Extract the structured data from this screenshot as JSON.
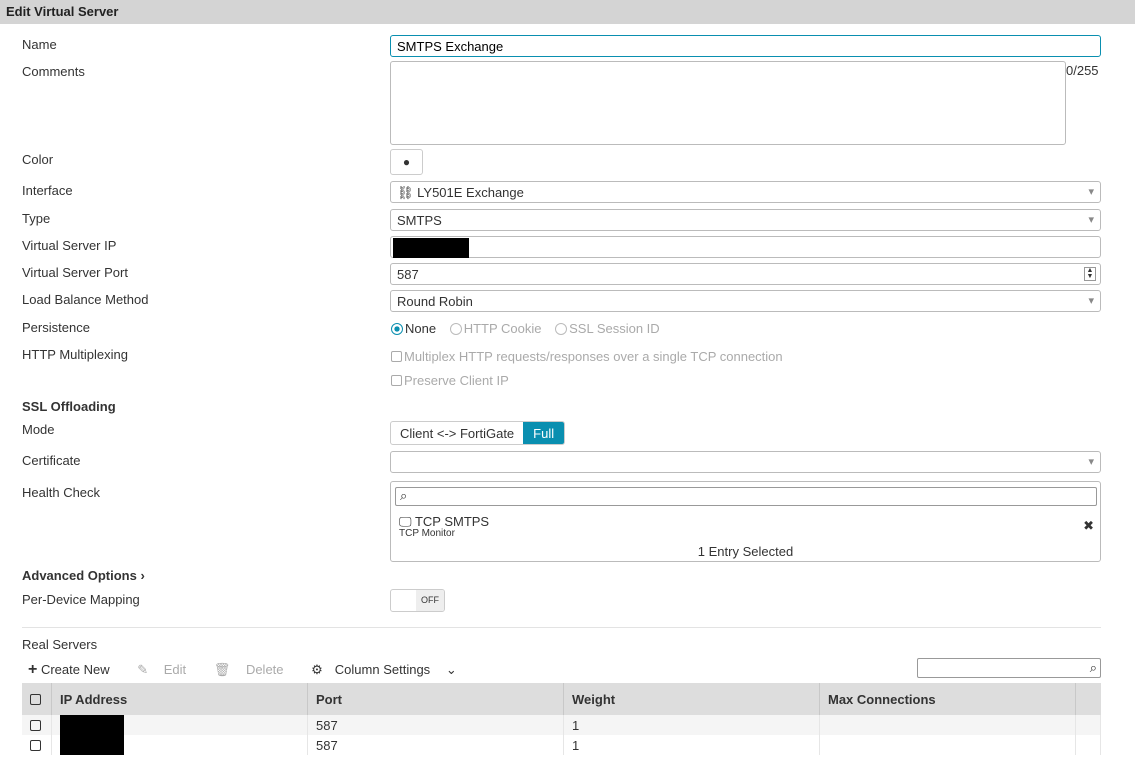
{
  "title": "Edit Virtual Server",
  "labels": {
    "name": "Name",
    "comments": "Comments",
    "color": "Color",
    "interface": "Interface",
    "type": "Type",
    "vip": "Virtual Server IP",
    "vport": "Virtual Server Port",
    "lbm": "Load Balance Method",
    "persistence": "Persistence",
    "http_mux": "HTTP Multiplexing",
    "ssl": "SSL Offloading",
    "mode": "Mode",
    "cert": "Certificate",
    "health": "Health Check",
    "advanced": "Advanced Options",
    "pdm": "Per-Device Mapping",
    "real_servers": "Real Servers"
  },
  "fields": {
    "name": "SMTPS Exchange",
    "comments_count": "0/255",
    "interface": "LY501E Exchange",
    "type": "SMTPS",
    "vport": "587",
    "lbm": "Round Robin",
    "certificate": ""
  },
  "persistence": {
    "options": [
      "None",
      "HTTP Cookie",
      "SSL Session ID"
    ],
    "selected": "None"
  },
  "http": {
    "multiplex": "Multiplex HTTP requests/responses over a single TCP connection",
    "preserve": "Preserve Client IP"
  },
  "mode": {
    "options": [
      "Client <-> FortiGate",
      "Full"
    ],
    "selected": "Full"
  },
  "health_check": {
    "item": "TCP SMTPS",
    "sub": "TCP Monitor",
    "count": "1 Entry Selected"
  },
  "pdm_toggle": "OFF",
  "toolbar": {
    "create": "Create New",
    "edit": "Edit",
    "delete": "Delete",
    "columns": "Column Settings"
  },
  "table": {
    "headers": [
      "IP Address",
      "Port",
      "Weight",
      "Max Connections"
    ],
    "rows": [
      {
        "port": "587",
        "weight": "1",
        "max": ""
      },
      {
        "port": "587",
        "weight": "1",
        "max": ""
      }
    ]
  },
  "colors": {
    "accent": "#0a8fb0"
  }
}
